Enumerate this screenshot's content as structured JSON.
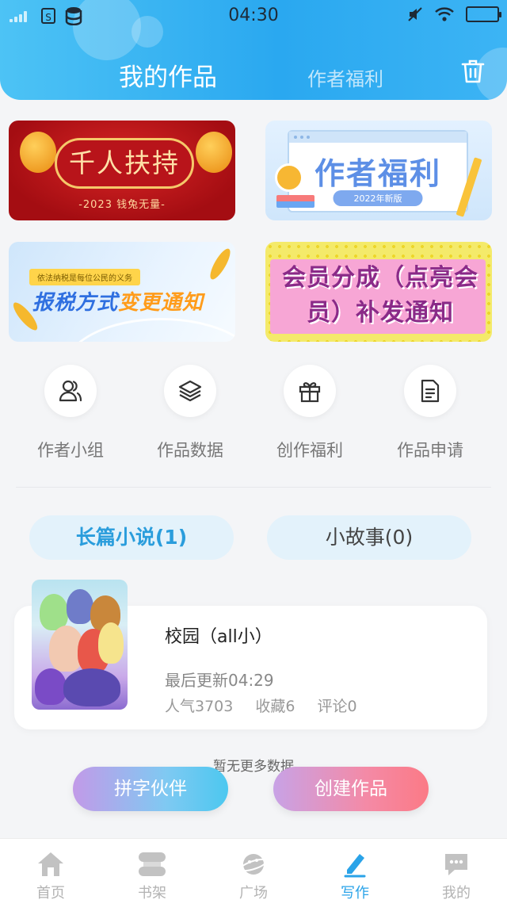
{
  "status_bar": {
    "time": "04:30",
    "sim_label": "S"
  },
  "header": {
    "title": "我的作品",
    "secondary_tab": "作者福利"
  },
  "banners": [
    {
      "title": "千人扶持",
      "subtitle": "-2023 钱兔无量-"
    },
    {
      "title": "作者福利",
      "subtitle": "2022年新版"
    },
    {
      "tag": "依法纳税是每位公民的义务",
      "title_part1": "报税方式",
      "title_part2": "变更通知"
    },
    {
      "title": "会员分成（点亮会员）补发通知"
    }
  ],
  "quick_actions": [
    {
      "label": "作者小组",
      "icon": "users-icon"
    },
    {
      "label": "作品数据",
      "icon": "layers-icon"
    },
    {
      "label": "创作福利",
      "icon": "gift-icon"
    },
    {
      "label": "作品申请",
      "icon": "document-icon"
    }
  ],
  "category_tabs": [
    {
      "label": "长篇小说(1)",
      "active": true
    },
    {
      "label": "小故事(0)",
      "active": false
    }
  ],
  "works": [
    {
      "title": "校园（all小）",
      "updated": "最后更新04:29",
      "popularity": "人气3703",
      "favorites": "收藏6",
      "comments": "评论0"
    }
  ],
  "no_more": "暂无更多数据",
  "actions": {
    "partner": "拼字伙伴",
    "create": "创建作品"
  },
  "tabbar": [
    {
      "label": "首页",
      "icon": "home-icon",
      "active": false
    },
    {
      "label": "书架",
      "icon": "bookshelf-icon",
      "active": false
    },
    {
      "label": "广场",
      "icon": "planet-icon",
      "active": false
    },
    {
      "label": "写作",
      "icon": "pen-icon",
      "active": true
    },
    {
      "label": "我的",
      "icon": "chat-icon",
      "active": false
    }
  ],
  "colors": {
    "accent": "#2aa3e8",
    "header_start": "#4dc3f5",
    "header_end": "#2aa8f0"
  }
}
